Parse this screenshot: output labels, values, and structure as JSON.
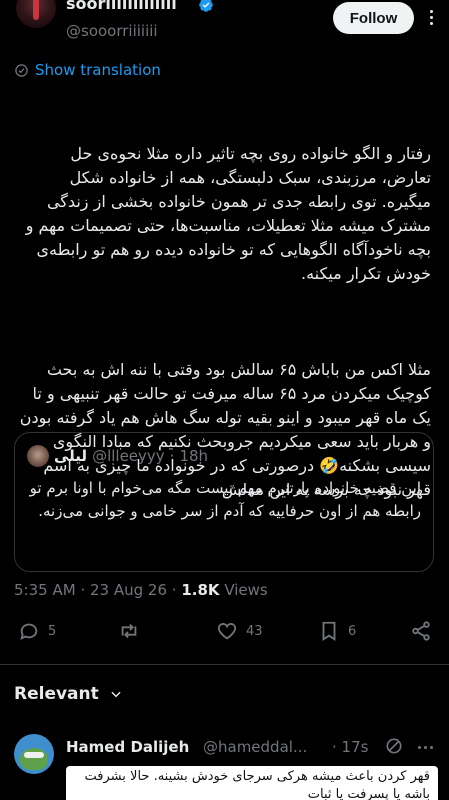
{
  "author": {
    "display_name": "sooriiiiiiiiiiiii",
    "handle": "@sooorriiiiiii",
    "follow_label": "Follow"
  },
  "translate_label": "Show translation",
  "tweet": {
    "paragraph1": "رفتار و الگو خانواده روی بچه تاثیر داره مثلا نحوه‌ی حل تعارض، مرزبندی، سبک دلبستگی، همه از خانواده شکل میگیره. توی رابطه جدی تر همون خانواده بخشی از زندگی مشترک میشه مثلا تعطیلات، مناسبت‌ها، حتی تصمیمات مهم و بچه ناخودآگاه الگوهایی که تو خانواده دیده رو هم تو رابطه‌ی خودش تکرار میکنه.",
    "paragraph2": "مثلا اکس من باباش ۶۵ سالش بود وقتی با ننه اش به بحث کوچیک میکردن مرد ۶۵ ساله میرفت تو حالت قهر تنبیهی و تا یک ماه قهر میبود و اینو بقیه توله سگ هاش هم یاد گرفته بودن و هربار باید سعی میکردیم جروبحث نکنیم که مبادا النگوی سیسی بشکنه🤣 درصورتی که در خونواده ما چیزی به اسم قهر نبود چه برسه به این مدلش"
  },
  "quote": {
    "name": "لیلی",
    "handle": "@llleeyyy",
    "dot": "·",
    "time": "18h",
    "text": "این قضیه خانواده پارتنرم مهم نیست مگه می‌خوام با اونا برم تو رابطه هم از اون حرفاییه که آدم از سر خامی و جوانی می‌زنه."
  },
  "meta": {
    "time": "5:35 AM",
    "date": "23 Aug 26",
    "views_count": "1.8K",
    "views_label": "Views",
    "sep": "·"
  },
  "actions": {
    "replies": "5",
    "likes": "43",
    "bookmarks": "6"
  },
  "relevant_label": "Relevant",
  "reply": {
    "name": "Hamed Dalijeh",
    "handle": "@hameddal...",
    "time": "· 17s",
    "text": "قهر کردن باعث میشه هرکی سرجای خودش بشینه. حالا بشرفت باشه یا پسرفت یا ثبات"
  },
  "colors": {
    "accent": "#1d9bf0",
    "muted": "#71767b",
    "text": "#e7e9ea",
    "border": "#2f3336"
  }
}
